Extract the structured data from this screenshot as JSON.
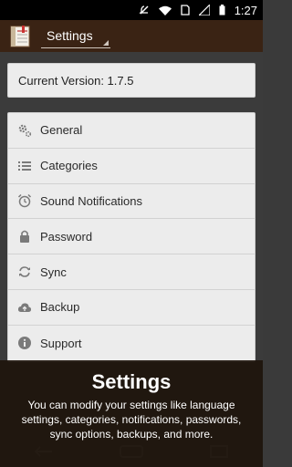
{
  "status_bar": {
    "time": "1:27",
    "icons": [
      "mute-icon",
      "wifi-icon",
      "sim-icon",
      "signal-icon",
      "battery-icon"
    ]
  },
  "action_bar": {
    "app_icon": "notebook-app-icon",
    "spinner_label": "Settings"
  },
  "version": {
    "text": "Current Version: 1.7.5"
  },
  "menu": {
    "items": [
      {
        "label": "General",
        "icon": "gears-icon"
      },
      {
        "label": "Categories",
        "icon": "list-icon"
      },
      {
        "label": "Sound Notifications",
        "icon": "alarm-clock-icon"
      },
      {
        "label": "Password",
        "icon": "lock-icon"
      },
      {
        "label": "Sync",
        "icon": "sync-icon"
      },
      {
        "label": "Backup",
        "icon": "cloud-upload-icon"
      },
      {
        "label": "Support",
        "icon": "info-icon"
      }
    ]
  },
  "overlay": {
    "title": "Settings",
    "description": "You can modify your settings like language settings, categories, notifications, passwords, sync options, backups, and more."
  },
  "navbar": {
    "buttons": [
      "back-icon",
      "home-icon",
      "recents-icon"
    ]
  },
  "colors": {
    "action_bar": "#3a2314",
    "background": "#3b3b3b",
    "card": "#ececec",
    "overlay": "#1e140c"
  }
}
